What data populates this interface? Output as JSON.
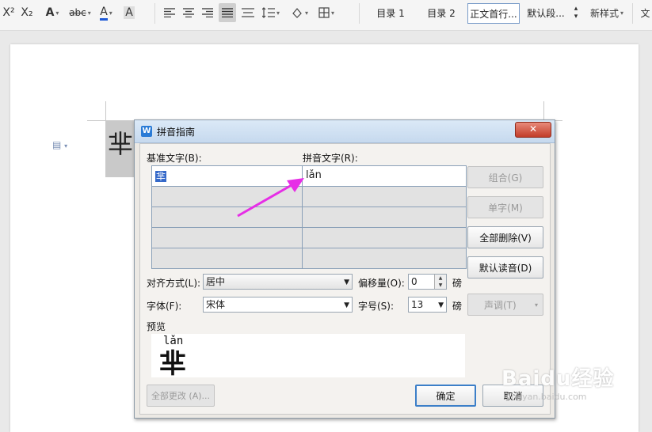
{
  "ribbon": {
    "superscript": "X²",
    "subscript": "X₂",
    "text_effect": "A",
    "pinyin_icon": "abc",
    "font_color": "A",
    "char_shading": "A",
    "styles": [
      "目录 1",
      "目录 2",
      "正文首行...",
      "默认段..."
    ],
    "new_style": "新样式",
    "cut_label": "文"
  },
  "document": {
    "character": "芈"
  },
  "dialog": {
    "title": "拼音指南",
    "close": "✕",
    "base_text_label": "基准文字(B):",
    "pinyin_text_label": "拼音文字(R):",
    "rows": [
      {
        "base": "芈",
        "pinyin": "lǎn"
      },
      {
        "base": "",
        "pinyin": ""
      },
      {
        "base": "",
        "pinyin": ""
      },
      {
        "base": "",
        "pinyin": ""
      },
      {
        "base": "",
        "pinyin": ""
      }
    ],
    "buttons": {
      "group": "组合(G)",
      "single": "单字(M)",
      "delete_all": "全部删除(V)",
      "default_reading": "默认读音(D)",
      "tone": "声调(T)",
      "change_all": "全部更改 (A)...",
      "ok": "确定",
      "cancel": "取消"
    },
    "alignment_label": "对齐方式(L):",
    "alignment_value": "居中",
    "offset_label": "偏移量(O):",
    "offset_value": "0",
    "unit": "磅",
    "font_label": "字体(F):",
    "font_value": "宋体",
    "size_label": "字号(S):",
    "size_value": "13",
    "preview_label": "预览",
    "preview_pinyin": "lǎn",
    "preview_char": "芈"
  },
  "watermark": {
    "brand": "Baidu经验",
    "url": "jingyan.baidu.com"
  },
  "colors": {
    "arrow": "#e62ee6",
    "selection": "#3569c9"
  }
}
